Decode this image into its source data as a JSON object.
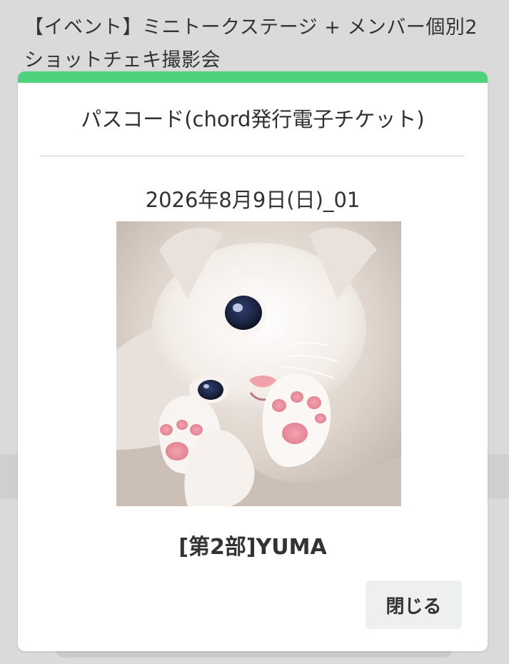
{
  "page": {
    "background_title_lines": [
      "【イベント】ミニトークステージ + メンバー個別2",
      "ショットチェキ撮影会"
    ]
  },
  "modal": {
    "title": "パスコード(chord発行電子チケット)",
    "date_label": "2026年8月9日(日)_01",
    "member_label": "[第2部]YUMA",
    "close_label": "閉じる",
    "accent_color": "#4fd27c"
  },
  "image": {
    "description_icon": "kitten-photo"
  }
}
